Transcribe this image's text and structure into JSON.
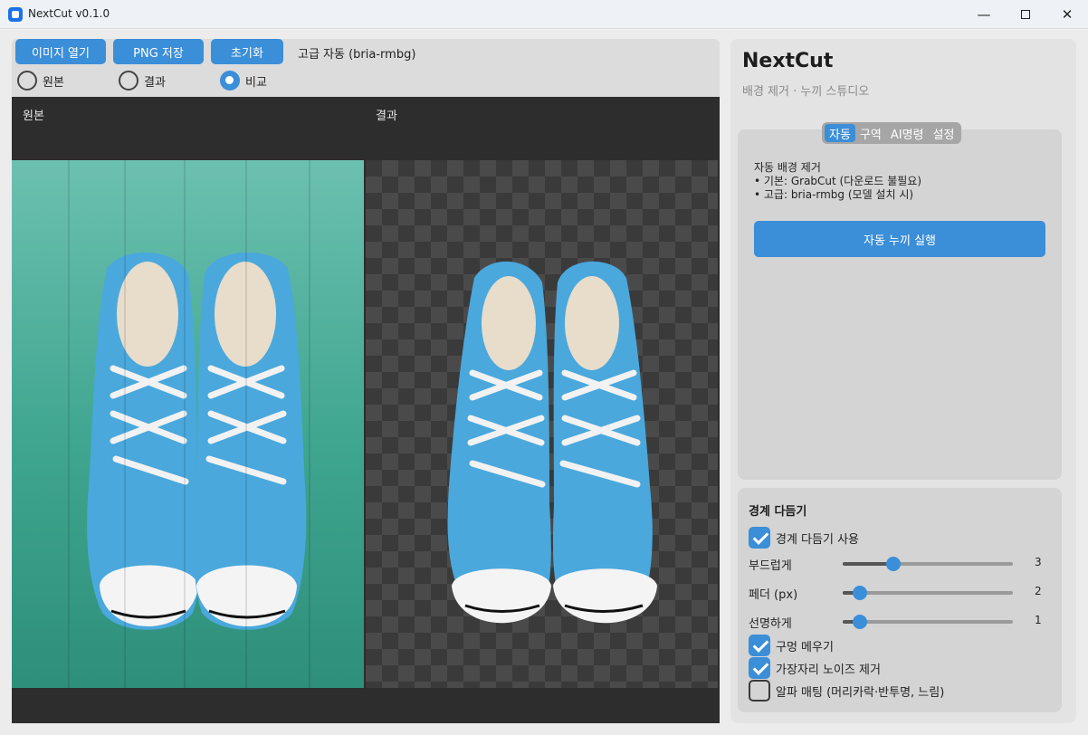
{
  "window": {
    "title": "NextCut v0.1.0"
  },
  "toolbar": {
    "open_label": "이미지 열기",
    "save_label": "PNG 저장",
    "reset_label": "초기화",
    "mode_status": "고급 자동 (bria-rmbg)"
  },
  "view_modes": [
    {
      "label": "원본",
      "selected": false
    },
    {
      "label": "결과",
      "selected": false
    },
    {
      "label": "비교",
      "selected": true
    }
  ],
  "viewer": {
    "left_label": "원본",
    "right_label": "결과"
  },
  "sidebar": {
    "brand": "NextCut",
    "subtitle": "배경 제거 · 누끼 스튜디오",
    "tabs": [
      {
        "label": "자동",
        "active": true
      },
      {
        "label": "구역",
        "active": false
      },
      {
        "label": "AI명령",
        "active": false
      },
      {
        "label": "설정",
        "active": false
      }
    ],
    "auto": {
      "desc_title": "자동 배경 제거",
      "desc_basic": "• 기본: GrabCut (다운로드 불필요)",
      "desc_advanced": "• 고급: bria-rmbg (모델 설치 시)",
      "run_label": "자동 누끼 실행"
    },
    "edge": {
      "title": "경계 다듬기",
      "use_refine": {
        "label": "경계 다듬기 사용",
        "checked": true
      },
      "sliders": [
        {
          "label": "부드럽게",
          "value": "3",
          "fraction": 0.3
        },
        {
          "label": "페더 (px)",
          "value": "2",
          "fraction": 0.1
        },
        {
          "label": "선명하게",
          "value": "1",
          "fraction": 0.1
        }
      ],
      "fill_holes": {
        "label": "구멍 메우기",
        "checked": true
      },
      "denoise": {
        "label": "가장자리 노이즈 제거",
        "checked": true
      },
      "alpha_matting": {
        "label": "알파 매팅 (머리카락·반투명, 느림)",
        "checked": false
      }
    }
  },
  "colors": {
    "accent": "#3b8ed8",
    "viewer_bg": "#2d2d2d",
    "panel_bg": "#e3e3e3"
  }
}
